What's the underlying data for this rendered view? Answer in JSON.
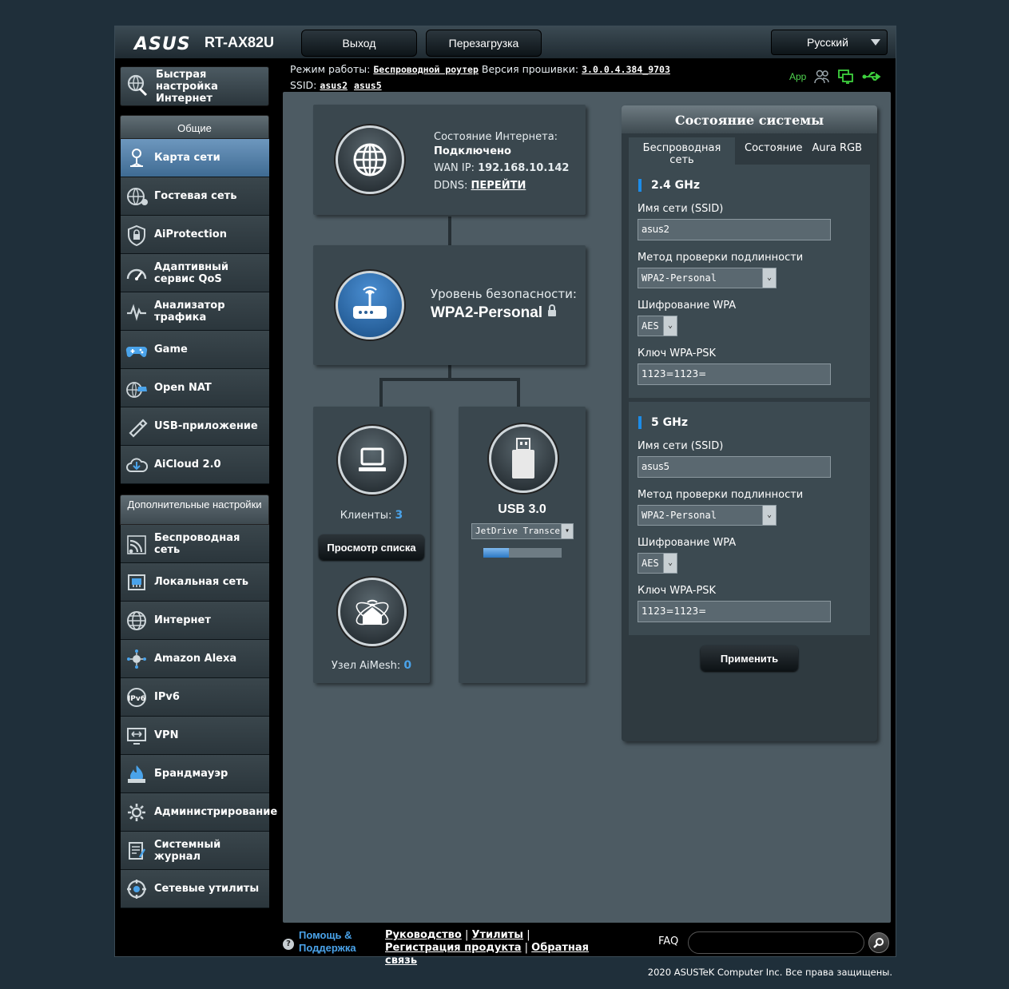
{
  "header": {
    "brand": "ASUS",
    "model": "RT-AX82U",
    "logout": "Выход",
    "reboot": "Перезагрузка",
    "language": "Русский",
    "mode_label": "Режим работы:",
    "mode_value": "Беспроводной роутер",
    "fw_label": "Версия прошивки:",
    "fw_value": "3.0.0.4.384_9703",
    "ssid_label": "SSID:",
    "ssid1": "asus2",
    "ssid2": "asus5",
    "app": "App"
  },
  "sidebar": {
    "quick_setup": "Быстрая настройка Интернет",
    "general_title": "Общие",
    "general": [
      {
        "label": "Карта сети",
        "icon": "network-map-icon",
        "active": true
      },
      {
        "label": "Гостевая сеть",
        "icon": "guest-network-icon"
      },
      {
        "label": "AiProtection",
        "icon": "aiprotection-icon"
      },
      {
        "label": "Адаптивный сервис QoS",
        "icon": "qos-icon"
      },
      {
        "label": "Анализатор трафика",
        "icon": "traffic-analyzer-icon"
      },
      {
        "label": "Game",
        "icon": "gamepad-icon"
      },
      {
        "label": "Open NAT",
        "icon": "open-nat-icon"
      },
      {
        "label": "USB-приложение",
        "icon": "usb-app-icon"
      },
      {
        "label": "AiCloud 2.0",
        "icon": "aicloud-icon"
      }
    ],
    "advanced_title": "Дополнительные настройки",
    "advanced": [
      {
        "label": "Беспроводная сеть",
        "icon": "wireless-icon"
      },
      {
        "label": "Локальная сеть",
        "icon": "lan-icon"
      },
      {
        "label": "Интернет",
        "icon": "internet-globe-icon"
      },
      {
        "label": "Amazon Alexa",
        "icon": "alexa-icon"
      },
      {
        "label": "IPv6",
        "icon": "ipv6-icon"
      },
      {
        "label": "VPN",
        "icon": "vpn-icon"
      },
      {
        "label": "Брандмауэр",
        "icon": "firewall-icon"
      },
      {
        "label": "Администрирование",
        "icon": "admin-gear-icon"
      },
      {
        "label": "Системный журнал",
        "icon": "syslog-icon"
      },
      {
        "label": "Сетевые утилиты",
        "icon": "network-tools-icon"
      }
    ]
  },
  "map": {
    "internet_status_label": "Состояние Интернета:",
    "internet_status": "Подключено",
    "wan_ip_label": "WAN IP:",
    "wan_ip": "192.168.10.142",
    "ddns_label": "DDNS:",
    "ddns_link": "ПЕРЕЙТИ",
    "security_label": "Уровень безопасности:",
    "security_value": "WPA2-Personal",
    "clients_label": "Клиенты:",
    "clients_count": "3",
    "view_list": "Просмотр списка",
    "aimesh_label": "Узел AiMesh:",
    "aimesh_count": "0",
    "usb_title": "USB 3.0",
    "usb_device": "JetDrive Transcend",
    "usb_usage": 0.33
  },
  "status": {
    "title": "Состояние системы",
    "tabs": [
      "Беспроводная сеть",
      "Состояние",
      "Aura RGB"
    ],
    "bands": [
      {
        "name": "2.4 GHz",
        "ssid_label": "Имя сети (SSID)",
        "ssid": "asus2",
        "auth_label": "Метод проверки подлинности",
        "auth": "WPA2-Personal",
        "enc_label": "Шифрование WPA",
        "enc": "AES",
        "key_label": "Ключ WPA-PSK",
        "key": "1123=1123="
      },
      {
        "name": "5 GHz",
        "ssid_label": "Имя сети (SSID)",
        "ssid": "asus5",
        "auth_label": "Метод проверки подлинности",
        "auth": "WPA2-Personal",
        "enc_label": "Шифрование WPA",
        "enc": "AES",
        "key_label": "Ключ WPA-PSK",
        "key": "1123=1123="
      }
    ],
    "apply": "Применить"
  },
  "footer": {
    "help": "Помощь & Поддержка",
    "manual": "Руководство",
    "utilities": "Утилиты",
    "registration": "Регистрация продукта",
    "feedback": "Обратная связь",
    "faq": "FAQ",
    "copyright": "2020 ASUSTeK Computer Inc. Все права защищены."
  }
}
